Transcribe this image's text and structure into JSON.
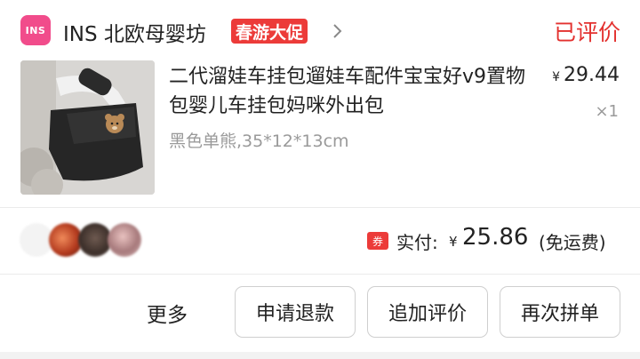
{
  "shop": {
    "logo_text": "INS",
    "name": "INS 北欧母婴坊",
    "promo_badge": "春游大促",
    "chevron_icon": "chevron-right-icon"
  },
  "order": {
    "status": "已评价"
  },
  "product": {
    "title": "二代溜娃车挂包遛娃车配件宝宝好v9置物包婴儿车挂包妈咪外出包",
    "spec": "黑色单熊,35*12*13cm",
    "price_symbol": "¥",
    "price": "29.44",
    "quantity": "×1"
  },
  "payment": {
    "tag": "券",
    "label": "实付:",
    "symbol": "¥",
    "amount": "25.86",
    "note": "(免运费)"
  },
  "actions": {
    "more": "更多",
    "refund": "申请退款",
    "append_review": "追加评价",
    "reorder": "再次拼单"
  },
  "colors": {
    "accent_red": "#e3312f",
    "promo_red": "#ec3b39",
    "logo_pink": "#f14c8b"
  }
}
